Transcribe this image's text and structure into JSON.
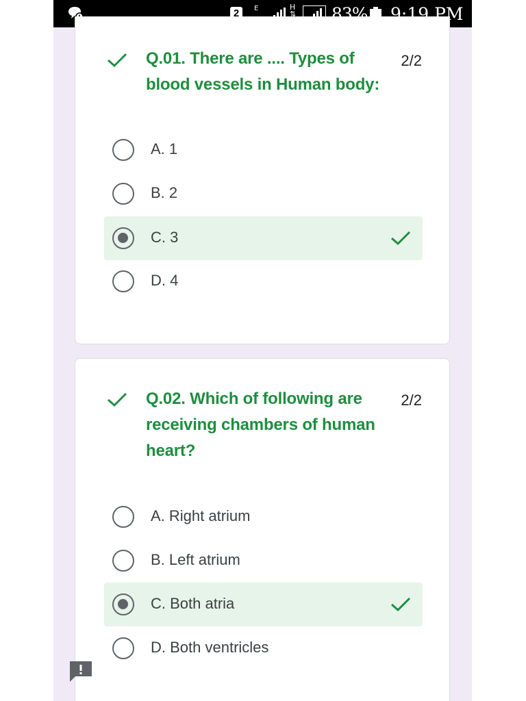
{
  "status_bar": {
    "sim_badge": "2",
    "network_e": "E",
    "network_h": "H",
    "battery_percent": "83%",
    "time": "9:19 PM"
  },
  "questions": [
    {
      "title": "Q.01. There are .... Types of blood vessels in Human body:",
      "score": "2/2",
      "options": [
        {
          "label": "A. 1",
          "selected": false,
          "correct": false
        },
        {
          "label": "B. 2",
          "selected": false,
          "correct": false
        },
        {
          "label": "C. 3",
          "selected": true,
          "correct": true
        },
        {
          "label": "D. 4",
          "selected": false,
          "correct": false
        }
      ]
    },
    {
      "title": "Q.02. Which of following are receiving chambers of human heart?",
      "score": "2/2",
      "options": [
        {
          "label": "A. Right atrium",
          "selected": false,
          "correct": false
        },
        {
          "label": "B. Left atrium",
          "selected": false,
          "correct": false
        },
        {
          "label": "C. Both atria",
          "selected": true,
          "correct": true
        },
        {
          "label": "D. Both ventricles",
          "selected": false,
          "correct": false
        }
      ]
    }
  ],
  "icons": {
    "question_correct": "checkmark-icon",
    "option_correct": "checkmark-icon",
    "feedback": "report-feedback-icon",
    "status_app": "chat-bubble-icon"
  },
  "colors": {
    "correct_green": "#1e8e3e",
    "selected_bg": "#e6f4ea",
    "page_bg": "#efeaf6"
  }
}
